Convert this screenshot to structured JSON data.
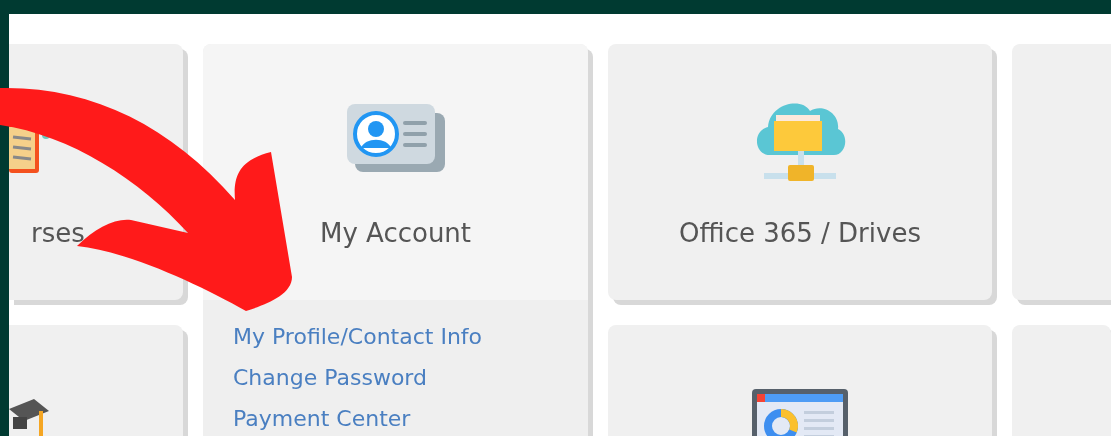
{
  "tiles": [
    {
      "title": "rses",
      "kind": "book",
      "expanded": false
    },
    {
      "title": "My Account",
      "kind": "id-card",
      "expanded": true,
      "links": [
        "My Profile/Contact Info",
        "Change Password",
        "Payment Center"
      ]
    },
    {
      "title": "Office 365 / Drives",
      "kind": "cloud-folder",
      "expanded": false
    },
    {
      "kind": "blank",
      "expanded": false
    },
    {
      "kind": "graduation-cap",
      "expanded": false
    },
    {
      "kind": "report",
      "expanded": false
    },
    {
      "kind": "blank",
      "expanded": false
    }
  ],
  "annotation": {
    "kind": "curved-arrow"
  }
}
